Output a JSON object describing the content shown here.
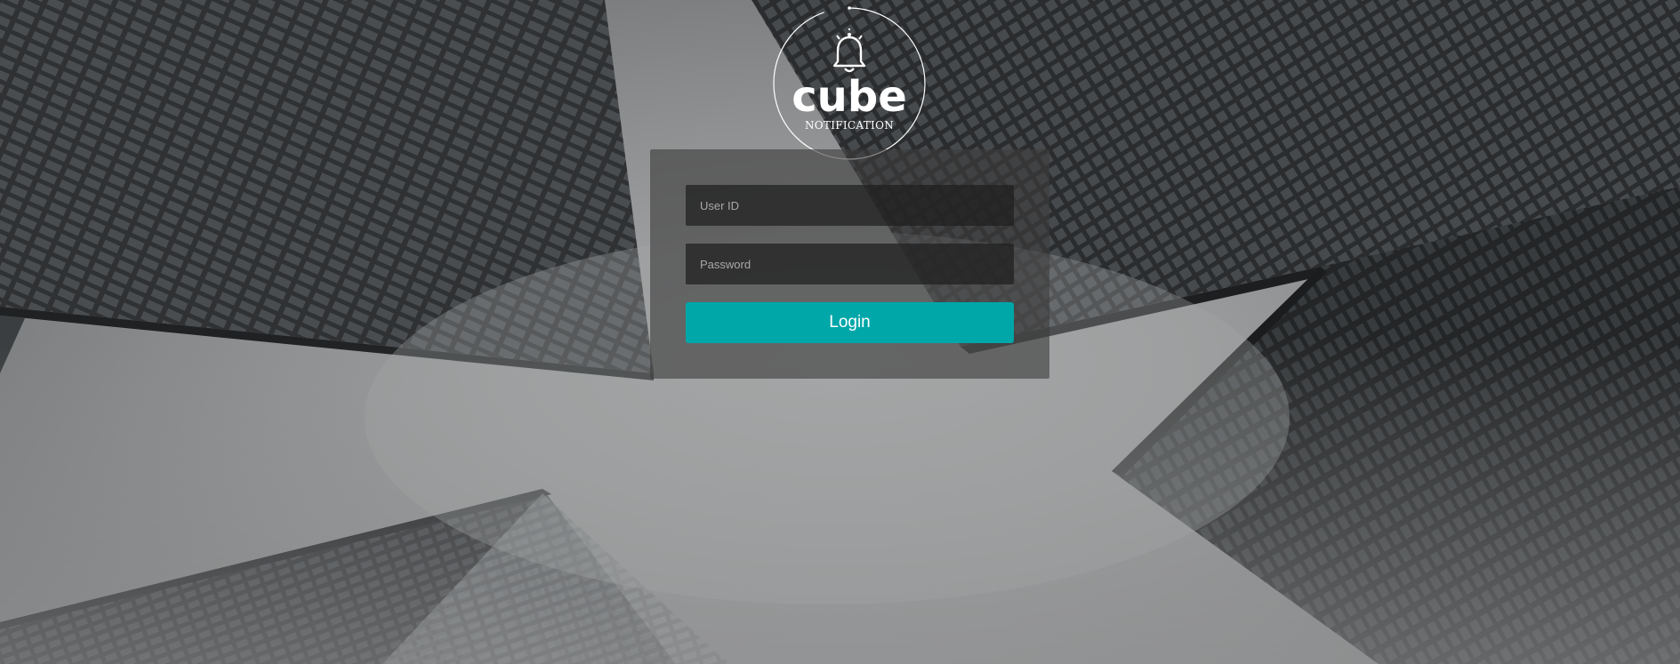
{
  "app": {
    "logo_word": "cube",
    "logo_subtitle": "NOTIFICATION",
    "logo_icon": "bell-icon"
  },
  "login_form": {
    "userid_placeholder": "User ID",
    "userid_value": "",
    "password_placeholder": "Password",
    "password_value": "",
    "login_label": "Login"
  },
  "colors": {
    "accent": "#00a7a9",
    "panel": "#3e3e3e",
    "field": "#1e1e1e",
    "text": "#ffffff"
  }
}
